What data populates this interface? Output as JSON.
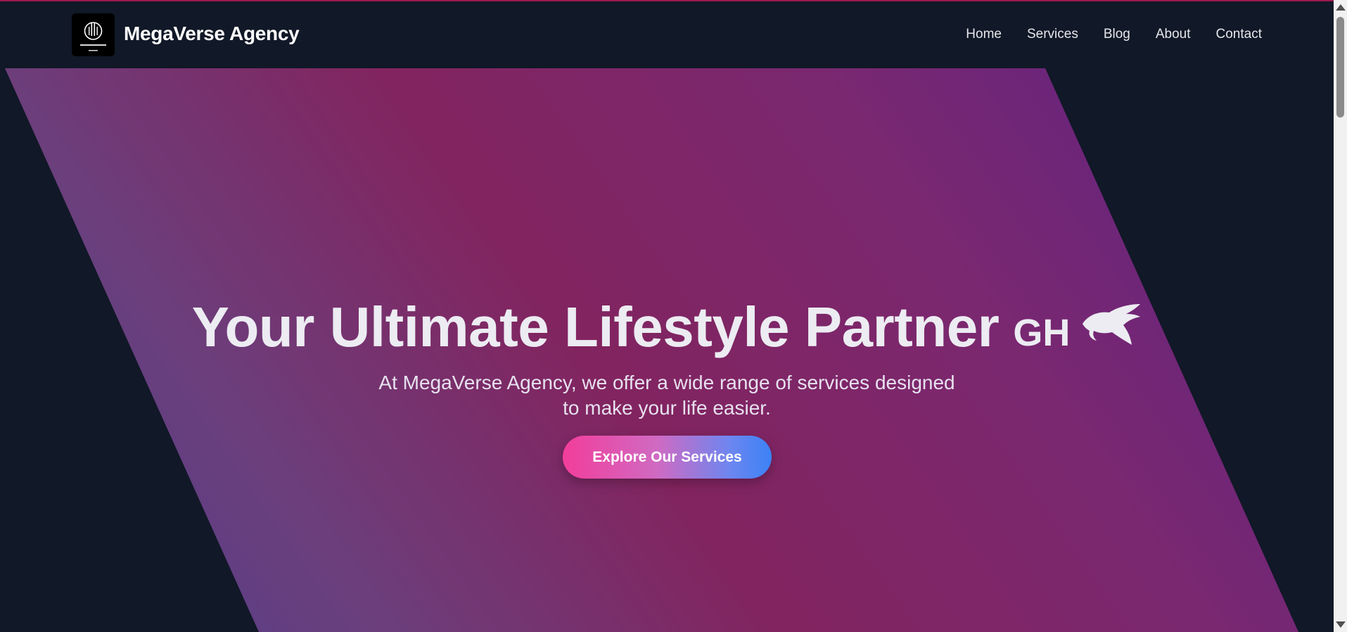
{
  "header": {
    "brand": "MegaVerse Agency",
    "logo_icon": "megaverse-logo",
    "nav": [
      {
        "label": "Home"
      },
      {
        "label": "Services"
      },
      {
        "label": "Blog"
      },
      {
        "label": "About"
      },
      {
        "label": "Contact"
      }
    ]
  },
  "hero": {
    "title": "Your Ultimate Lifestyle Partner",
    "flag_text": "GH",
    "flag_icon": "eagle-icon",
    "subtitle_line1": "At MegaVerse Agency, we offer a wide range of services designed",
    "subtitle_line2": "to make your life easier.",
    "cta_label": "Explore Our Services"
  },
  "colors": {
    "background": "#0f172a",
    "header_bg": "#111827",
    "accent_pink": "#f23d9a",
    "accent_blue": "#3b82f6",
    "hero_purple": "#82245f"
  }
}
